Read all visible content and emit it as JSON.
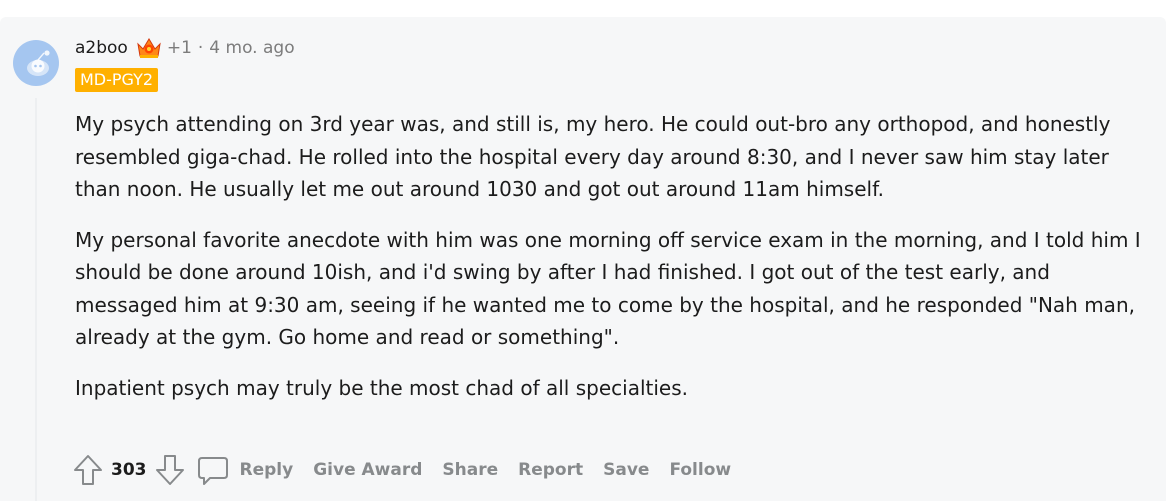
{
  "comment": {
    "author": "a2boo",
    "award_count": "+1",
    "separator": "·",
    "timestamp": "4 mo. ago",
    "flair": "MD-PGY2",
    "paragraphs": [
      "My psych attending on 3rd year was, and still is, my hero. He could out-bro any orthopod, and honestly resembled giga-chad. He rolled into the hospital every day around 8:30, and I never saw him stay later than noon. He usually let me out around 1030 and got out around 11am himself.",
      "My personal favorite anecdote with him was one morning off service exam in the morning, and I told him I should be done around 10ish, and i'd swing by after I had finished. I got out of the test early, and messaged him at 9:30 am, seeing if he wanted me to come by the hospital, and he responded \"Nah man, already at the gym. Go home and read or something\".",
      "Inpatient psych may truly be the most chad of all specialties."
    ],
    "score": "303",
    "actions": {
      "reply": "Reply",
      "give_award": "Give Award",
      "share": "Share",
      "report": "Report",
      "save": "Save",
      "follow": "Follow"
    }
  },
  "colors": {
    "card_bg": "#f6f7f8",
    "flair_bg": "#ffb000",
    "meta_text": "#7c7c7c",
    "action_text": "#878a8c",
    "avatar_bg": "#a5c6f0"
  },
  "icons": {
    "avatar": "snoo-avatar-icon",
    "award": "crown-award-icon",
    "upvote": "arrow-up-icon",
    "downvote": "arrow-down-icon",
    "comment": "speech-bubble-icon"
  }
}
